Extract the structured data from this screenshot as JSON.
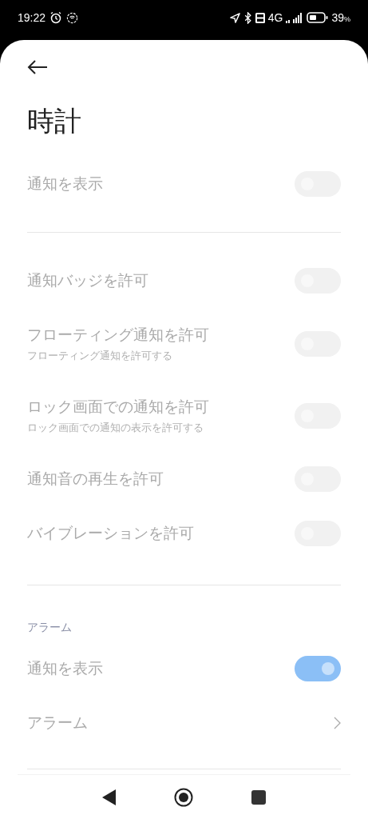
{
  "status_bar": {
    "time": "19:22",
    "network": "4G",
    "battery": "39",
    "battery_unit": "%"
  },
  "title": "時計",
  "sections": [
    {
      "items": [
        {
          "kind": "toggle",
          "title": "通知を表示",
          "on": false,
          "disabled": true
        }
      ]
    },
    {
      "items": [
        {
          "kind": "toggle",
          "title": "通知バッジを許可",
          "on": false,
          "disabled": true
        },
        {
          "kind": "toggle",
          "title": "フローティング通知を許可",
          "subtitle": "フローティング通知を許可する",
          "on": false,
          "disabled": true
        },
        {
          "kind": "toggle",
          "title": "ロック画面での通知を許可",
          "subtitle": "ロック画面での通知の表示を許可する",
          "on": false,
          "disabled": true
        },
        {
          "kind": "toggle",
          "title": "通知音の再生を許可",
          "on": false,
          "disabled": true
        },
        {
          "kind": "toggle",
          "title": "バイブレーションを許可",
          "on": false,
          "disabled": true
        }
      ]
    },
    {
      "label": "アラーム",
      "items": [
        {
          "kind": "toggle",
          "title": "通知を表示",
          "on": true,
          "disabled": true
        },
        {
          "kind": "link",
          "title": "アラーム",
          "disabled": true
        }
      ]
    }
  ]
}
